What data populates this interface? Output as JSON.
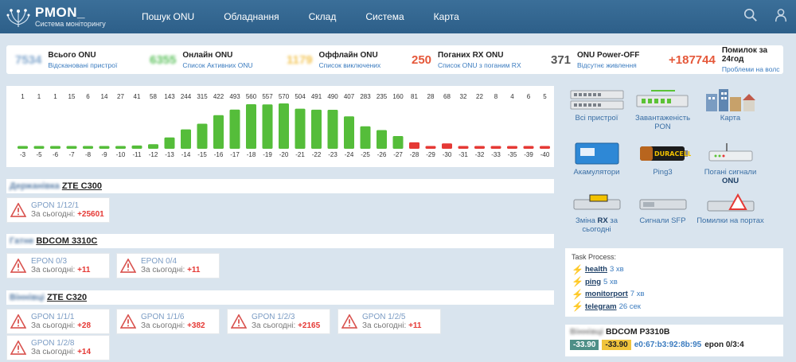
{
  "header": {
    "app_title": "PMON_",
    "app_subtitle": "Система моніторингу",
    "nav": [
      "Пошук ONU",
      "Обладнання",
      "Склад",
      "Система",
      "Карта"
    ]
  },
  "stats": [
    {
      "value": "7534",
      "label": "Всього ONU",
      "link": "Відскановані пристрої",
      "color": "#7fa5cc",
      "blurred": true
    },
    {
      "value": "6355",
      "label": "Онлайн ONU",
      "link": "Список Активних ONU",
      "color": "#5ec25e",
      "blurred": true
    },
    {
      "value": "1179",
      "label": "Оффлайн ONU",
      "link": "Список виключених",
      "color": "#f3c453",
      "blurred": true
    },
    {
      "value": "250",
      "label": "Поганих RX ONU",
      "link": "Список ONU з поганим RX",
      "color": "#e5583a",
      "blurred": false
    },
    {
      "value": "371",
      "label": "ONU Power-OFF",
      "link": "Відсутнє живлення",
      "color": "#555555",
      "blurred": false
    },
    {
      "value": "+187744",
      "label": "Помилок за 24год",
      "link": "Проблеми на волс",
      "color": "#e5583a",
      "blurred": false
    }
  ],
  "chart_data": {
    "type": "bar",
    "categories": [
      "-3",
      "-5",
      "-6",
      "-7",
      "-8",
      "-9",
      "-10",
      "-11",
      "-12",
      "-13",
      "-14",
      "-15",
      "-16",
      "-17",
      "-18",
      "-19",
      "-20",
      "-21",
      "-22",
      "-23",
      "-24",
      "-25",
      "-26",
      "-27",
      "-28",
      "-29",
      "-30",
      "-31",
      "-32",
      "-33",
      "-35",
      "-39",
      "-40"
    ],
    "values": [
      1,
      1,
      1,
      15,
      6,
      14,
      27,
      41,
      58,
      143,
      244,
      315,
      422,
      493,
      560,
      557,
      570,
      504,
      491,
      490,
      407,
      283,
      235,
      160,
      81,
      28,
      68,
      32,
      22,
      8,
      4,
      6,
      5
    ],
    "colors": {
      "good": "#55bd3a",
      "bad": "#e53935"
    },
    "bad_from_index": 24
  },
  "olts": [
    {
      "blur_name": "Держанівка",
      "name": "ZTE C300",
      "alarms": [
        {
          "port": "GPON 1/12/1",
          "today_label": "За сьогодні:",
          "count": "+25601"
        }
      ]
    },
    {
      "blur_name": "Гатне",
      "name": "BDCOM 3310C",
      "alarms": [
        {
          "port": "EPON 0/3",
          "today_label": "За сьогодні:",
          "count": "+11"
        },
        {
          "port": "EPON 0/4",
          "today_label": "За сьогодні:",
          "count": "+11"
        }
      ]
    },
    {
      "blur_name": "Віннівці",
      "name": "ZTE C320",
      "alarms": [
        {
          "port": "GPON 1/1/1",
          "today_label": "За сьогодні:",
          "count": "+28"
        },
        {
          "port": "GPON 1/1/6",
          "today_label": "За сьогодні:",
          "count": "+382"
        },
        {
          "port": "GPON 1/2/3",
          "today_label": "За сьогодні:",
          "count": "+2165"
        },
        {
          "port": "GPON 1/2/5",
          "today_label": "За сьогодні:",
          "count": "+11"
        },
        {
          "port": "GPON 1/2/8",
          "today_label": "За сьогодні:",
          "count": "+14"
        }
      ]
    }
  ],
  "tiles": [
    {
      "label": "Всі пристрої",
      "icon": "switch-rack-icon"
    },
    {
      "label": "Завантаженість PON",
      "icon": "pon-load-icon"
    },
    {
      "label": "Карта",
      "icon": "city-map-icon"
    },
    {
      "label": "Акамулятори",
      "icon": "battery-icon"
    },
    {
      "label": "Ping3",
      "icon": "ping-battery-icon"
    },
    {
      "label_pre": "Погані сигнали ",
      "label_bold": "ONU",
      "icon": "onu-router-icon"
    },
    {
      "label_pre": "Зміна ",
      "label_bold": "RX",
      "label_post": " за сьогодні",
      "icon": "sfp-warning-icon"
    },
    {
      "label": "Сигнали SFP",
      "icon": "sfp-module-icon"
    },
    {
      "label": "Помилки на портах",
      "icon": "sfp-error-icon"
    }
  ],
  "task_process": {
    "title": "Task Process:",
    "tasks": [
      {
        "name": "health",
        "time": "3 хв"
      },
      {
        "name": "ping",
        "time": "5 хв"
      },
      {
        "name": "monitorport",
        "time": "7 хв"
      },
      {
        "name": "telegram",
        "time": "26 сек"
      }
    ]
  },
  "olt_box": {
    "blur_name": "Віннівці",
    "name": "BDCOM P3310B",
    "rx1": "-33.90",
    "rx2": "-33.90",
    "mac": "e0:67:b3:92:8b:95",
    "port": "epon 0/3:4"
  }
}
